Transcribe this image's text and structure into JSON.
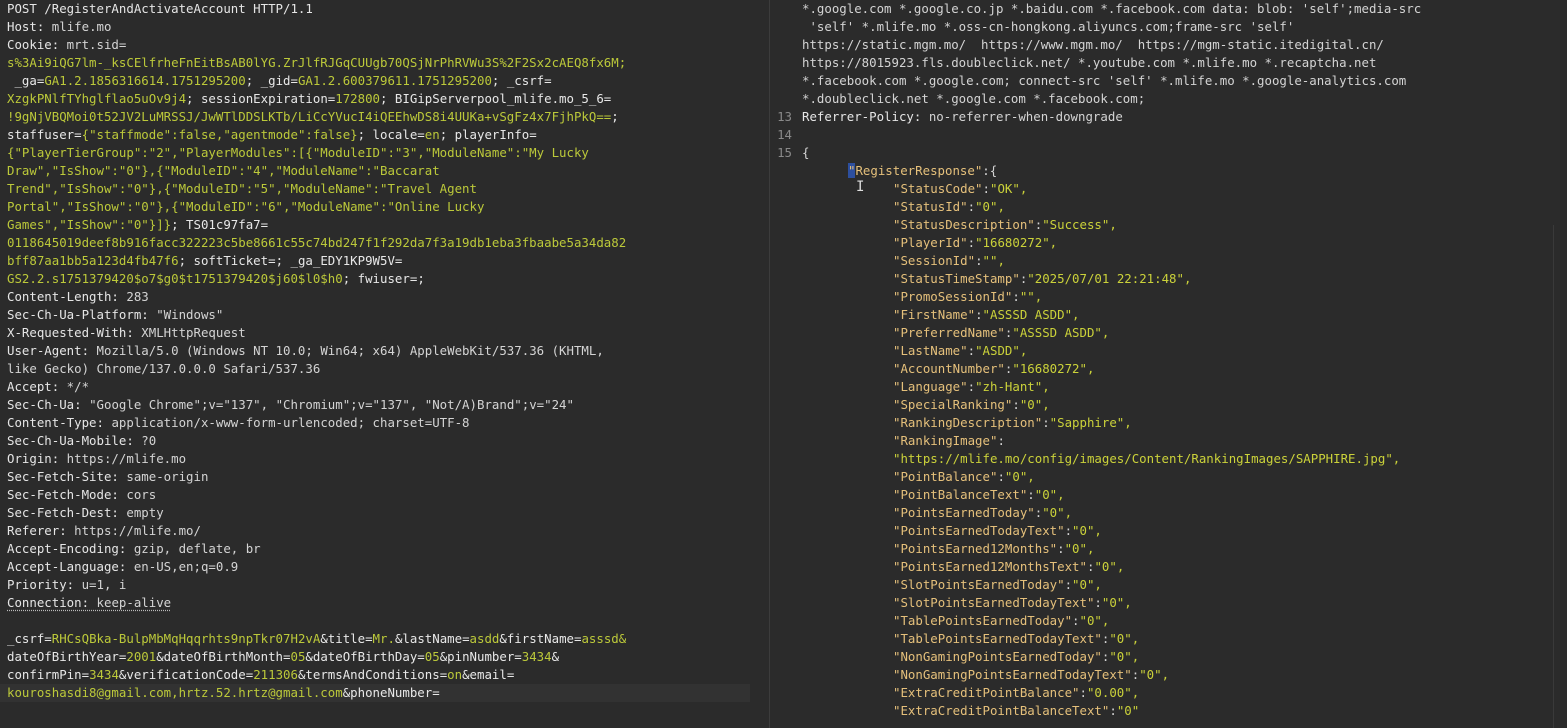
{
  "request": {
    "request_line": "POST /RegisterAndActivateAccount HTTP/1.1",
    "headers": [
      {
        "name": "Host:",
        "value": " mlife.mo"
      },
      {
        "name": "Cookie:",
        "value": " mrt.sid="
      },
      {
        "cookie": [
          [
            "",
            "s%3Ai9iQG7lm-_ksCElfrheFnEitBsAB0lYG.ZrJlfRJGqCUUgb70QSjNrPhRVWu3S%2F2Sx2cAEQ8fx6M;"
          ]
        ]
      },
      {
        "cookie": [
          [
            " _ga=",
            "GA1.2.1856316614.1751295200"
          ],
          [
            "; _gid=",
            "GA1.2.600379611.1751295200"
          ],
          [
            "; _csrf=",
            ""
          ]
        ]
      },
      {
        "cookie": [
          [
            "",
            "XzgkPNlfTYhglflao5uOv9j4"
          ],
          [
            "; sessionExpiration=",
            "172800"
          ],
          [
            "; BIGipServerpool_mlife.mo_5_6=",
            ""
          ]
        ]
      },
      {
        "cookie": [
          [
            "",
            "!9gNjVBQMoi0t52JV2LuMRSSJ/JwWTlDDSLKTb/LiCcYVucI4iQEEhwDS8i4UUKa+vSgFz4x7FjhPkQ=="
          ],
          [
            ";",
            ""
          ]
        ]
      },
      {
        "cookie": [
          [
            "staffuser=",
            "{\"staffmode\":false,\"agentmode\":false}"
          ],
          [
            "; locale=",
            "en"
          ],
          [
            "; playerInfo=",
            ""
          ]
        ]
      },
      {
        "cookie": [
          [
            "",
            "{\"PlayerTierGroup\":\"2\",\"PlayerModules\":[{\"ModuleID\":\"3\",\"ModuleName\":\"My Lucky"
          ]
        ]
      },
      {
        "cookie": [
          [
            "",
            "Draw\",\"IsShow\":\"0\"},{\"ModuleID\":\"4\",\"ModuleName\":\"Baccarat"
          ]
        ]
      },
      {
        "cookie": [
          [
            "",
            "Trend\",\"IsShow\":\"0\"},{\"ModuleID\":\"5\",\"ModuleName\":\"Travel Agent"
          ]
        ]
      },
      {
        "cookie": [
          [
            "",
            "Portal\",\"IsShow\":\"0\"},{\"ModuleID\":\"6\",\"ModuleName\":\"Online Lucky"
          ]
        ]
      },
      {
        "cookie": [
          [
            "",
            "Games\",\"IsShow\":\"0\"}]}"
          ],
          [
            "; TS01c97fa7=",
            ""
          ]
        ]
      },
      {
        "cookie": [
          [
            "",
            "0118645019deef8b916facc322223c5be8661c55c74bd247f1f292da7f3a19db1eba3fbaabe5a34da82"
          ]
        ]
      },
      {
        "cookie": [
          [
            "",
            "bff87aa1bb5a123d4fb47f6"
          ],
          [
            "; softTicket=",
            ""
          ],
          [
            "; _ga_EDY1KP9W5V=",
            ""
          ]
        ]
      },
      {
        "cookie": [
          [
            "",
            "GS2.2.s1751379420$o7$g0$t1751379420$j60$l0$h0"
          ],
          [
            "; fwiuser=",
            ""
          ],
          [
            ";",
            ""
          ]
        ]
      },
      {
        "name": "Content-Length:",
        "value": " 283"
      },
      {
        "name": "Sec-Ch-Ua-Platform:",
        "value": " \"Windows\""
      },
      {
        "name": "X-Requested-With:",
        "value": " XMLHttpRequest"
      },
      {
        "name": "User-Agent:",
        "value": " Mozilla/5.0 (Windows NT 10.0; Win64; x64) AppleWebKit/537.36 (KHTML,"
      },
      {
        "name": "",
        "value": "like Gecko) Chrome/137.0.0.0 Safari/537.36"
      },
      {
        "name": "Accept:",
        "value": " */*"
      },
      {
        "name": "Sec-Ch-Ua:",
        "value": " \"Google Chrome\";v=\"137\", \"Chromium\";v=\"137\", \"Not/A)Brand\";v=\"24\""
      },
      {
        "name": "Content-Type:",
        "value": " application/x-www-form-urlencoded; charset=UTF-8"
      },
      {
        "name": "Sec-Ch-Ua-Mobile:",
        "value": " ?0"
      },
      {
        "name": "Origin:",
        "value": " https://mlife.mo"
      },
      {
        "name": "Sec-Fetch-Site:",
        "value": " same-origin"
      },
      {
        "name": "Sec-Fetch-Mode:",
        "value": " cors"
      },
      {
        "name": "Sec-Fetch-Dest:",
        "value": " empty"
      },
      {
        "name": "Referer:",
        "value": " https://mlife.mo/"
      },
      {
        "name": "Accept-Encoding:",
        "value": " gzip, deflate, br"
      },
      {
        "name": "Accept-Language:",
        "value": " en-US,en;q=0.9"
      },
      {
        "name": "Priority:",
        "value": " u=1, i"
      },
      {
        "name": "Connection:",
        "value": " keep-alive",
        "underline": true
      }
    ],
    "body_lines": [
      [
        [
          "_csrf=",
          "RHCsQBka-BulpMbMqHqqrhts9npTkr07H2vA"
        ],
        [
          "&title=",
          "Mr."
        ],
        [
          "&lastName=",
          "asdd"
        ],
        [
          "&firstName=",
          "asssd&"
        ]
      ],
      [
        [
          "dateOfBirthYear=",
          "2001"
        ],
        [
          "&dateOfBirthMonth=",
          "05"
        ],
        [
          "&dateOfBirthDay=",
          "05"
        ],
        [
          "&pinNumber=",
          "3434"
        ],
        [
          "&",
          ""
        ]
      ],
      [
        [
          "confirmPin=",
          "3434"
        ],
        [
          "&verificationCode=",
          "211306"
        ],
        [
          "&termsAndConditions=",
          "on"
        ],
        [
          "&email=",
          ""
        ]
      ],
      [
        [
          "",
          "kouroshasdi8@gmail.com,hrtz.52.hrtz@gmail.com"
        ],
        [
          "&phoneNumber=",
          ""
        ]
      ]
    ]
  },
  "response": {
    "csp_lines": [
      "*.google.com *.google.co.jp *.baidu.com *.facebook.com data: blob: 'self';media-src",
      " 'self' *.mlife.mo *.oss-cn-hongkong.aliyuncs.com;frame-src 'self'",
      "https://static.mgm.mo/  https://www.mgm.mo/  https://mgm-static.itedigital.cn/",
      "https://8015923.fls.doubleclick.net/ *.youtube.com *.mlife.mo *.recaptcha.net",
      "*.facebook.com *.google.com; connect-src 'self' *.mlife.mo *.google-analytics.com",
      "*.doubleclick.net *.google.com *.facebook.com;"
    ],
    "line13": {
      "num": "13",
      "name": "Referrer-Policy:",
      "value": " no-referrer-when-downgrade"
    },
    "line14": {
      "num": "14"
    },
    "line15": {
      "num": "15",
      "text": "{"
    },
    "root_key": "RegisterResponse",
    "fields": [
      {
        "k": "StatusCode",
        "v": "\"OK\","
      },
      {
        "k": "StatusId",
        "v": "\"0\","
      },
      {
        "k": "StatusDescription",
        "v": "\"Success\","
      },
      {
        "k": "PlayerId",
        "v": "\"16680272\","
      },
      {
        "k": "SessionId",
        "v": "\"\","
      },
      {
        "k": "StatusTimeStamp",
        "v": "\"2025/07/01 22:21:48\","
      },
      {
        "k": "PromoSessionId",
        "v": "\"\","
      },
      {
        "k": "FirstName",
        "v": "\"ASSSD ASDD\","
      },
      {
        "k": "PreferredName",
        "v": "\"ASSSD ASDD\","
      },
      {
        "k": "LastName",
        "v": "\"ASDD\","
      },
      {
        "k": "AccountNumber",
        "v": "\"16680272\","
      },
      {
        "k": "Language",
        "v": "\"zh-Hant\","
      },
      {
        "k": "SpecialRanking",
        "v": "\"0\","
      },
      {
        "k": "RankingDescription",
        "v": "\"Sapphire\","
      },
      {
        "k": "RankingImage",
        "v": ""
      },
      {
        "k": "",
        "v": "\"https://mlife.mo/config/images/Content/RankingImages/SAPPHIRE.jpg\","
      },
      {
        "k": "PointBalance",
        "v": "\"0\","
      },
      {
        "k": "PointBalanceText",
        "v": "\"0\","
      },
      {
        "k": "PointsEarnedToday",
        "v": "\"0\","
      },
      {
        "k": "PointsEarnedTodayText",
        "v": "\"0\","
      },
      {
        "k": "PointsEarned12Months",
        "v": "\"0\","
      },
      {
        "k": "PointsEarned12MonthsText",
        "v": "\"0\","
      },
      {
        "k": "SlotPointsEarnedToday",
        "v": "\"0\","
      },
      {
        "k": "SlotPointsEarnedTodayText",
        "v": "\"0\","
      },
      {
        "k": "TablePointsEarnedToday",
        "v": "\"0\","
      },
      {
        "k": "TablePointsEarnedTodayText",
        "v": "\"0\","
      },
      {
        "k": "NonGamingPointsEarnedToday",
        "v": "\"0\","
      },
      {
        "k": "NonGamingPointsEarnedTodayText",
        "v": "\"0\","
      },
      {
        "k": "ExtraCreditPointBalance",
        "v": "\"0.00\","
      },
      {
        "k": "ExtraCreditPointBalanceText",
        "v": "\"0\""
      }
    ]
  }
}
